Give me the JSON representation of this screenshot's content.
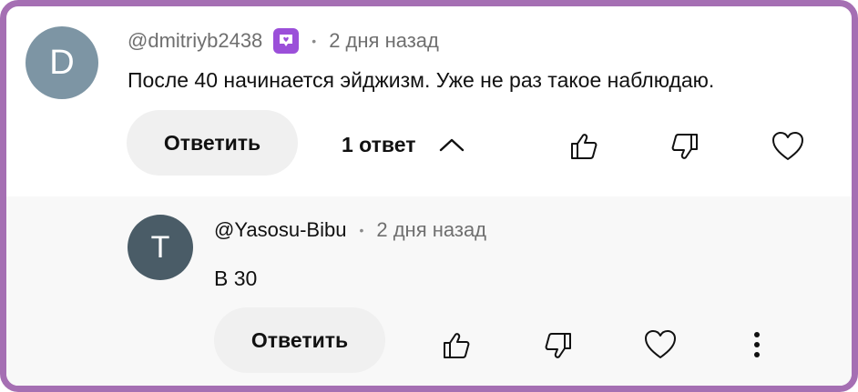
{
  "comment": {
    "avatar_letter": "D",
    "avatar_color": "#7d95a4",
    "author": "@dmitriyb2438",
    "badge_icon": "member-badge-icon",
    "badge_color": "#9b4fd9",
    "separator": "•",
    "time": "2 дня назад",
    "text": "После 40 начинается эйджизм. Уже не раз такое наблюдаю.",
    "reply_label": "Ответить",
    "replies_label": "1 ответ",
    "icons": [
      "chevron-up-icon",
      "thumbs-up-icon",
      "thumbs-down-icon",
      "heart-icon"
    ]
  },
  "reply": {
    "avatar_letter": "T",
    "avatar_color": "#4a5c67",
    "author": "@Yasosu-Bibu",
    "separator": "•",
    "time": "2 дня назад",
    "text": "В 30",
    "reply_label": "Ответить",
    "icons": [
      "thumbs-up-icon",
      "thumbs-down-icon",
      "heart-icon",
      "more-vertical-icon"
    ]
  },
  "frame_color": "#a56fb3"
}
